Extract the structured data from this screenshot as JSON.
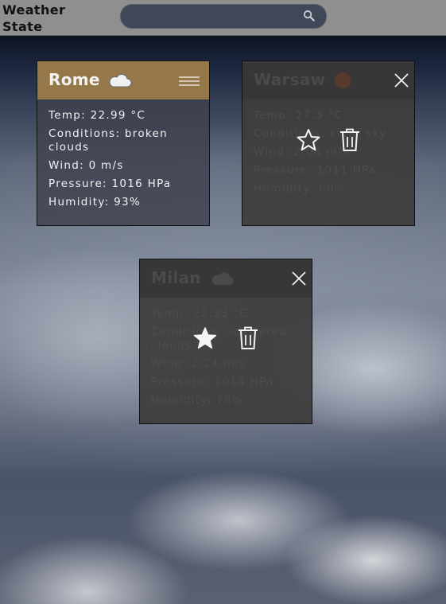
{
  "app": {
    "logo": "Weather State"
  },
  "search": {
    "placeholder": "",
    "value": ""
  },
  "cards": [
    {
      "city": "Rome",
      "weather_icon": "cloud-icon",
      "temp": "Temp: 22.99 °C",
      "conditions": "Conditions: broken clouds",
      "wind": "Wind: 0 m/s",
      "pressure": "Pressure: 1016 HPa",
      "humidity": "Humidity: 93%",
      "state": "active"
    },
    {
      "city": "Warsaw",
      "weather_icon": "sun-icon",
      "temp": "Temp: 27.3 °C",
      "conditions": "Conditions: clear sky",
      "wind": "Wind: 2.06 m/s",
      "pressure": "Pressure: 1011 HPa",
      "humidity": "Humidity: 60%",
      "state": "menu-open",
      "favorite": false
    },
    {
      "city": "Milan",
      "weather_icon": "cloud-icon",
      "temp": "Temp: 22.33 °C",
      "conditions": "Conditions: scattered clouds",
      "wind": "Wind: 2.24 m/s",
      "pressure": "Pressure: 1014 HPa",
      "humidity": "Humidity: 78%",
      "state": "menu-open",
      "favorite": true
    }
  ],
  "colors": {
    "active_header": "#95784a",
    "topbar": "#8f8f8f",
    "search_bg": "#404858"
  }
}
